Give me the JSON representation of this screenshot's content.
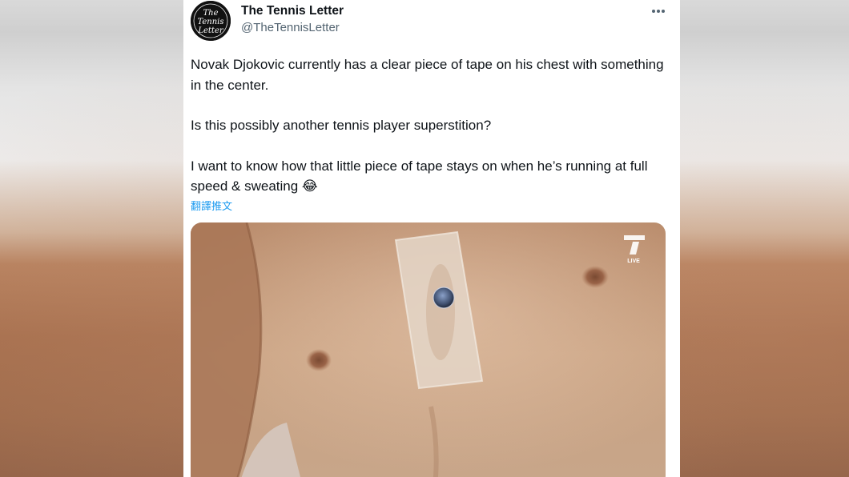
{
  "tweet": {
    "author_name": "The Tennis Letter",
    "author_handle": "@TheTennisLetter",
    "avatar_text_1": "The",
    "avatar_text_2": "Tennis",
    "avatar_text_3": "Letter",
    "more_label": "•••",
    "paragraphs": [
      "Novak Djokovic currently has a clear piece of tape on his chest with something in the center.",
      "Is this possibly another tennis player superstition?",
      "I want to know how that little piece of tape stays on when he’s running at full speed & sweating 😂"
    ],
    "translate_label": "翻譯推文",
    "media_logo_text": "LIVE"
  }
}
